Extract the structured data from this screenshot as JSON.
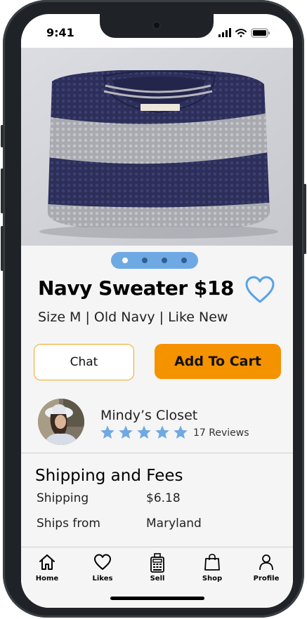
{
  "status_bar": {
    "time": "9:41"
  },
  "product": {
    "title": "Navy Sweater $18",
    "subtitle": "Size M | Old Navy | Like New",
    "image_count": 4,
    "active_image": 1
  },
  "actions": {
    "chat_label": "Chat",
    "cart_label": "Add To Cart"
  },
  "seller": {
    "name": "Mindy’s Closet",
    "rating": 5,
    "reviews": "17 Reviews"
  },
  "shipping": {
    "title": "Shipping and Fees",
    "rows": [
      {
        "label": "Shipping",
        "value": "$6.18"
      },
      {
        "label": "Ships from",
        "value": "Maryland"
      }
    ]
  },
  "tabbar": {
    "items": [
      {
        "label": "Home",
        "icon": "home-icon"
      },
      {
        "label": "Likes",
        "icon": "heart-icon"
      },
      {
        "label": "Sell",
        "icon": "register-icon"
      },
      {
        "label": "Shop",
        "icon": "shopping-bag-icon"
      },
      {
        "label": "Profile",
        "icon": "person-icon"
      }
    ]
  },
  "colors": {
    "accent": "#f59200",
    "highlight": "#6fa9e4",
    "star": "#6fa9e4"
  }
}
